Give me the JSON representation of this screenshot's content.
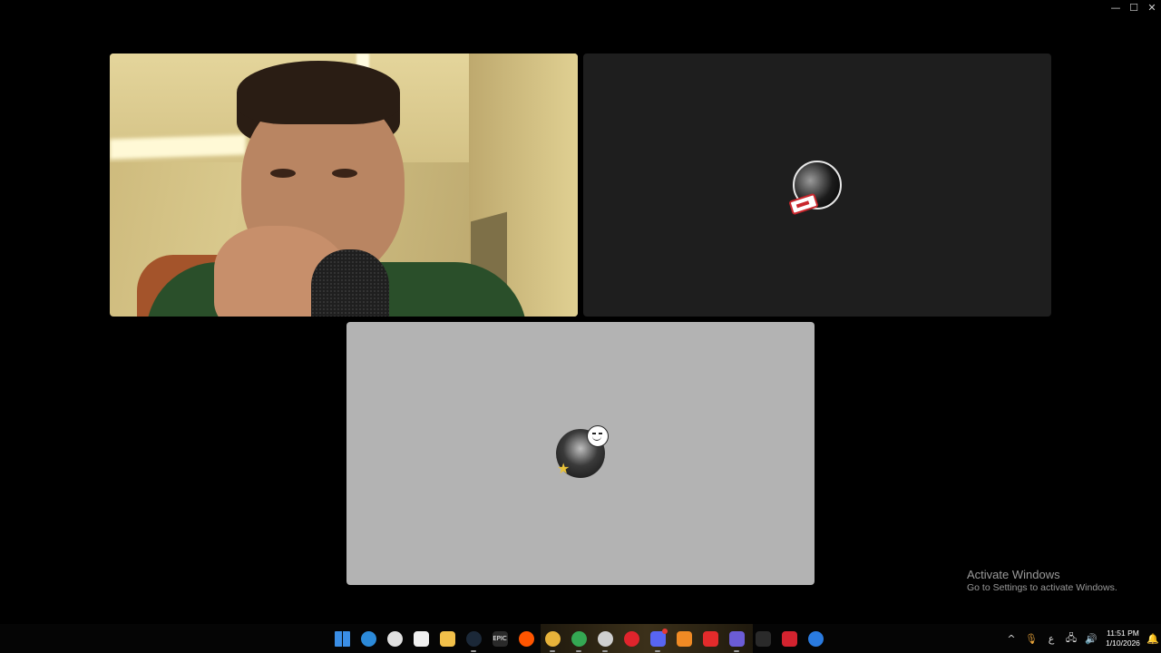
{
  "window": {
    "controls": [
      {
        "name": "minimize-icon",
        "glyph": "—"
      },
      {
        "name": "maximize-icon",
        "glyph": "☐"
      },
      {
        "name": "close-icon",
        "glyph": "✕"
      }
    ]
  },
  "tiles": [
    {
      "name": "participant-tile-camera",
      "type": "video"
    },
    {
      "name": "participant-tile-avatar-dark",
      "type": "avatar",
      "background": "#1e1e1e"
    },
    {
      "name": "participant-tile-avatar-grey",
      "type": "avatar",
      "background": "#b3b3b3"
    }
  ],
  "watermark": {
    "title": "Activate Windows",
    "subtitle": "Go to Settings to activate Windows."
  },
  "taskbar": {
    "pinned": [
      {
        "name": "windows-start-icon",
        "color": "#3a8ee6"
      },
      {
        "name": "edge-icon",
        "color": "#2c8ad9"
      },
      {
        "name": "steelseries-icon",
        "color": "#e0e0e0"
      },
      {
        "name": "microsoft-store-icon",
        "color": "#f0f0f0"
      },
      {
        "name": "file-explorer-icon",
        "color": "#f2c04a"
      },
      {
        "name": "steam-icon",
        "color": "#1b2838"
      },
      {
        "name": "epic-games-icon",
        "color": "#2a2a2a",
        "text": "EPIC"
      },
      {
        "name": "soundcloud-icon",
        "color": "#ff5500"
      },
      {
        "name": "chrome-icon",
        "color": "#e8b33a"
      },
      {
        "name": "chrome-alt-icon",
        "color": "#34a853"
      },
      {
        "name": "obs-icon",
        "color": "#cfcfcf"
      },
      {
        "name": "opera-icon",
        "color": "#e0242c"
      },
      {
        "name": "discord-icon",
        "color": "#5865f2",
        "badge": "24"
      },
      {
        "name": "app-orange-icon",
        "color": "#f08a24"
      },
      {
        "name": "bitdefender-icon",
        "color": "#e32b2b"
      },
      {
        "name": "media-player-icon",
        "color": "#6b5cd6"
      },
      {
        "name": "uc-icon",
        "color": "#2a2a2a"
      },
      {
        "name": "red-app-icon",
        "color": "#d3232f"
      },
      {
        "name": "blue-app-icon",
        "color": "#2a7be0"
      }
    ],
    "tray": {
      "items": [
        {
          "name": "show-hidden-icons-chevron",
          "glyph": "^"
        },
        {
          "name": "microphone-icon",
          "glyph": "🎙"
        },
        {
          "name": "language-indicator",
          "glyph": "ع"
        },
        {
          "name": "network-icon",
          "glyph": "🖧"
        },
        {
          "name": "volume-icon",
          "glyph": "🔊"
        }
      ],
      "time": "11:51 PM",
      "date": "1/10/2026",
      "notification_glyph": "🔔"
    }
  }
}
